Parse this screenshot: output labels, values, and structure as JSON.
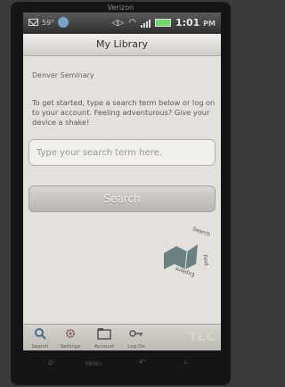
{
  "device": {
    "carrier": "Verizon"
  },
  "status_bar": {
    "temperature": "59°",
    "time": "1:01",
    "time_suffix": "PM"
  },
  "app": {
    "title": "My Library",
    "institution": "Denver Seminary",
    "intro_text": "To get started, type a search term below or log on to your account. Feeling adventurous? Give your device a shake!",
    "search_placeholder": "Type your search term here.",
    "search_button_label": "Search",
    "logo_text": "Search Find Explore"
  },
  "tabs": [
    {
      "label": "Search",
      "icon": "magnifier-icon"
    },
    {
      "label": "Settings",
      "icon": "gear-icon"
    },
    {
      "label": "Account",
      "icon": "folder-icon"
    },
    {
      "label": "Log On",
      "icon": "key-icon"
    }
  ],
  "brand_watermark": "TLC",
  "softkeys": [
    {
      "icon": "home-icon"
    },
    {
      "icon": "menu-icon",
      "label": "MENU"
    },
    {
      "icon": "back-icon"
    },
    {
      "icon": "search-icon"
    }
  ],
  "colors": {
    "screen_background": "#e4e1dc",
    "status_bar": "#3a3a3a",
    "battery": "#6fd86f",
    "search_button": "#c4c1bc"
  }
}
